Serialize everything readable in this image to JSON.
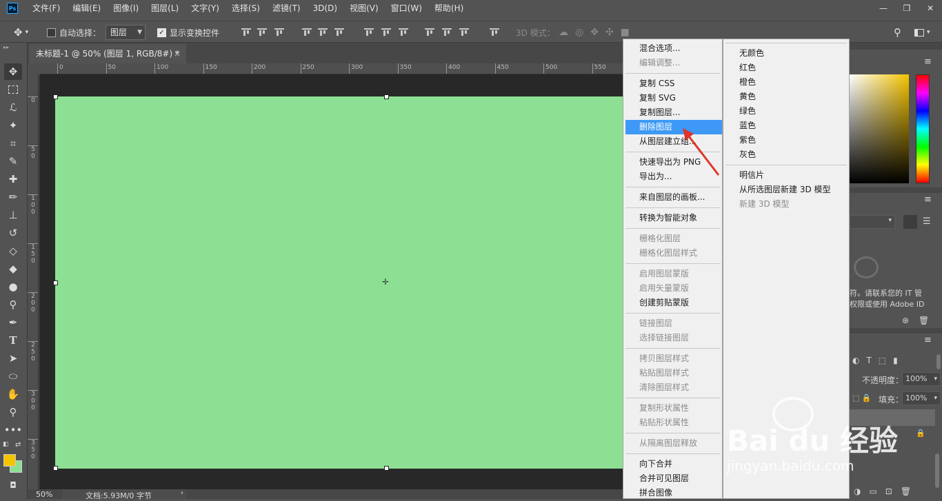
{
  "app": {
    "logo": "Ps"
  },
  "menubar": {
    "items": [
      "文件(F)",
      "编辑(E)",
      "图像(I)",
      "图层(L)",
      "文字(Y)",
      "选择(S)",
      "滤镜(T)",
      "3D(D)",
      "视图(V)",
      "窗口(W)",
      "帮助(H)"
    ]
  },
  "window_controls": {
    "minimize": "—",
    "restore": "❐",
    "close": "✕"
  },
  "options_bar": {
    "auto_select_label": "自动选择：",
    "auto_select_checked": false,
    "auto_select_target": "图层",
    "show_transform_label": "显示变换控件",
    "show_transform_checked": true,
    "mode_3d_label": "3D 模式："
  },
  "document_tab": {
    "title": "未标题-1 @ 50% (图层 1, RGB/8#) *",
    "close": "×"
  },
  "rulers": {
    "horizontal": [
      "0",
      "50",
      "100",
      "150",
      "200",
      "250",
      "300",
      "350",
      "400",
      "450",
      "500",
      "550"
    ],
    "vertical": [
      "0",
      "5\n0",
      "1\n0\n0",
      "1\n5\n0",
      "2\n0\n0",
      "2\n5\n0",
      "3\n0\n0",
      "3\n5\n0"
    ]
  },
  "canvas": {
    "layer_color": "#8de093"
  },
  "statusbar": {
    "zoom": "50%",
    "doc_info": "文档:5.93M/0 字节"
  },
  "context_menu": {
    "items": [
      {
        "label": "混合选项...",
        "state": "normal"
      },
      {
        "label": "编辑调整...",
        "state": "disabled"
      },
      {
        "label": "复制 CSS",
        "state": "normal"
      },
      {
        "label": "复制 SVG",
        "state": "normal"
      },
      {
        "label": "复制图层...",
        "state": "normal"
      },
      {
        "label": "删除图层",
        "state": "highlighted"
      },
      {
        "label": "从图层建立组...",
        "state": "normal"
      },
      {
        "label": "快速导出为 PNG",
        "state": "normal"
      },
      {
        "label": "导出为...",
        "state": "normal"
      },
      {
        "label": "来自图层的画板...",
        "state": "normal"
      },
      {
        "label": "转换为智能对象",
        "state": "normal"
      },
      {
        "label": "栅格化图层",
        "state": "disabled"
      },
      {
        "label": "栅格化图层样式",
        "state": "disabled"
      },
      {
        "label": "启用图层蒙版",
        "state": "disabled"
      },
      {
        "label": "启用矢量蒙版",
        "state": "disabled"
      },
      {
        "label": "创建剪贴蒙版",
        "state": "normal"
      },
      {
        "label": "链接图层",
        "state": "disabled"
      },
      {
        "label": "选择链接图层",
        "state": "disabled"
      },
      {
        "label": "拷贝图层样式",
        "state": "disabled"
      },
      {
        "label": "粘贴图层样式",
        "state": "disabled"
      },
      {
        "label": "清除图层样式",
        "state": "disabled"
      },
      {
        "label": "复制形状属性",
        "state": "disabled"
      },
      {
        "label": "粘贴形状属性",
        "state": "disabled"
      },
      {
        "label": "从隔离图层释放",
        "state": "disabled"
      },
      {
        "label": "向下合并",
        "state": "normal"
      },
      {
        "label": "合并可见图层",
        "state": "normal"
      },
      {
        "label": "拼合图像",
        "state": "normal"
      }
    ]
  },
  "context_menu_2": {
    "items": [
      {
        "label": "无颜色",
        "state": "normal"
      },
      {
        "label": "红色",
        "state": "normal"
      },
      {
        "label": "橙色",
        "state": "normal"
      },
      {
        "label": "黄色",
        "state": "normal"
      },
      {
        "label": "绿色",
        "state": "normal"
      },
      {
        "label": "蓝色",
        "state": "normal"
      },
      {
        "label": "紫色",
        "state": "normal"
      },
      {
        "label": "灰色",
        "state": "normal"
      },
      {
        "label": "明信片",
        "state": "normal"
      },
      {
        "label": "从所选图层新建 3D 模型",
        "state": "normal"
      },
      {
        "label": "新建 3D 模型",
        "state": "disabled"
      }
    ]
  },
  "right_panel": {
    "cc_text_1": "符。请联系您的 IT 管",
    "cc_text_2": "权限或使用 Adobe ID",
    "opacity_label": "不透明度：",
    "opacity_value": "100%",
    "fill_label": "填充：",
    "fill_value": "100%"
  },
  "colors": {
    "foreground": "#f5c400",
    "background": "#8de093",
    "accent": "#3d99f5"
  },
  "watermark": {
    "brand": "Bai du 经验",
    "url": "jingyan.baidu.com"
  }
}
